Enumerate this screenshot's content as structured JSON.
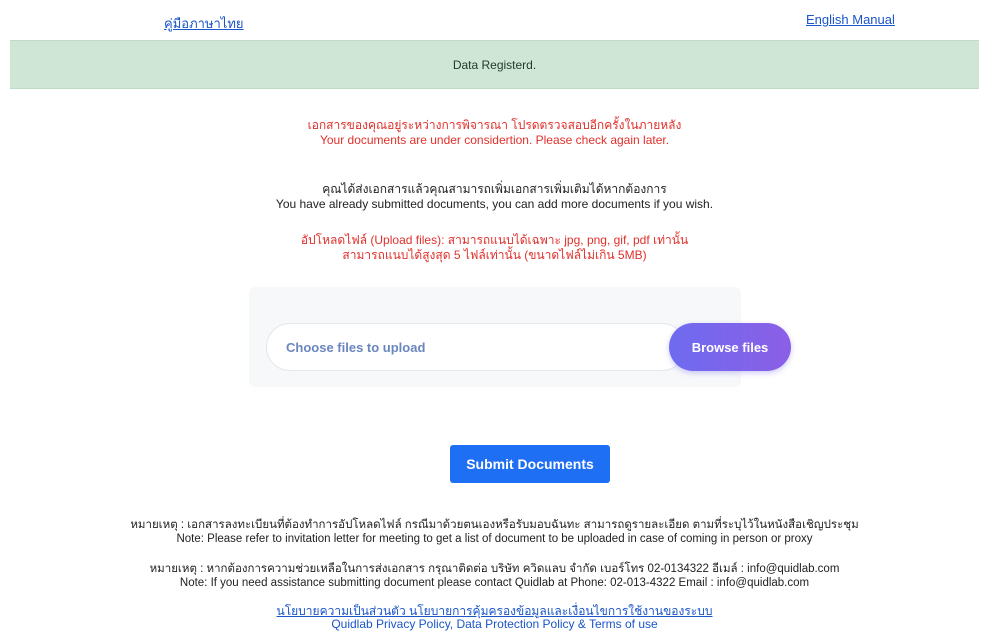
{
  "links": {
    "thai_manual": "คู่มือภาษาไทย",
    "english_manual": "English Manual"
  },
  "alert": {
    "text": "Data Registerd."
  },
  "status": {
    "line_th": "เอกสารของคุณอยู่ระหว่างการพิจารณา โปรดตรวจสอบอีกครั้งในภายหลัง",
    "line_en": "Your documents are under considertion. Please check again later."
  },
  "submitted": {
    "line_th": "คุณได้ส่งเอกสารแล้วคุณสามารถเพิ่มเอกสารเพิ่มเติมได้หากต้องการ",
    "line_en": "You have already submitted documents, you can add more documents if you wish."
  },
  "upload_rules": {
    "line1": "อัปโหลดไฟล์ (Upload files): สามารถแนบได้เฉพาะ jpg, png, gif, pdf เท่านั้น",
    "line2": "สามารถแนบได้สูงสุด 5 ไฟล์เท่านั้น (ขนาดไฟล์ไม่เกิน 5MB)"
  },
  "uploader": {
    "placeholder": "Choose files to upload",
    "browse_label": "Browse files"
  },
  "submit": {
    "label": "Submit Documents"
  },
  "notes": {
    "note1_th": "หมายเหตุ : เอกสารลงทะเบียนที่ต้องทำการอัปโหลดไฟล์ กรณีมาด้วยตนเองหรือรับมอบฉันทะ สามารถดูรายละเอียด ตามที่ระบุไว้ในหนังสือเชิญประชุม",
    "note1_en": "Note: Please refer to invitation letter for meeting to get a list of document to be uploaded in case of coming in person or proxy",
    "note2_th": "หมายเหตุ : หากต้องการความช่วยเหลือในการส่งเอกสาร กรุณาติดต่อ บริษัท ควิดแลบ จำกัด เบอร์โทร 02-0134322 อีเมล์ : info@quidlab.com",
    "note2_en": "Note: If you need assistance submitting document please contact Quidlab at Phone: 02-013-4322 Email : info@quidlab.com"
  },
  "policy": {
    "link_th": "นโยบายความเป็นส่วนตัว นโยบายการคุ้มครองข้อมูลและเงื่อนไขการใช้งานของระบบ",
    "link_en": "Quidlab Privacy Policy, Data Protection Policy & Terms of use"
  }
}
